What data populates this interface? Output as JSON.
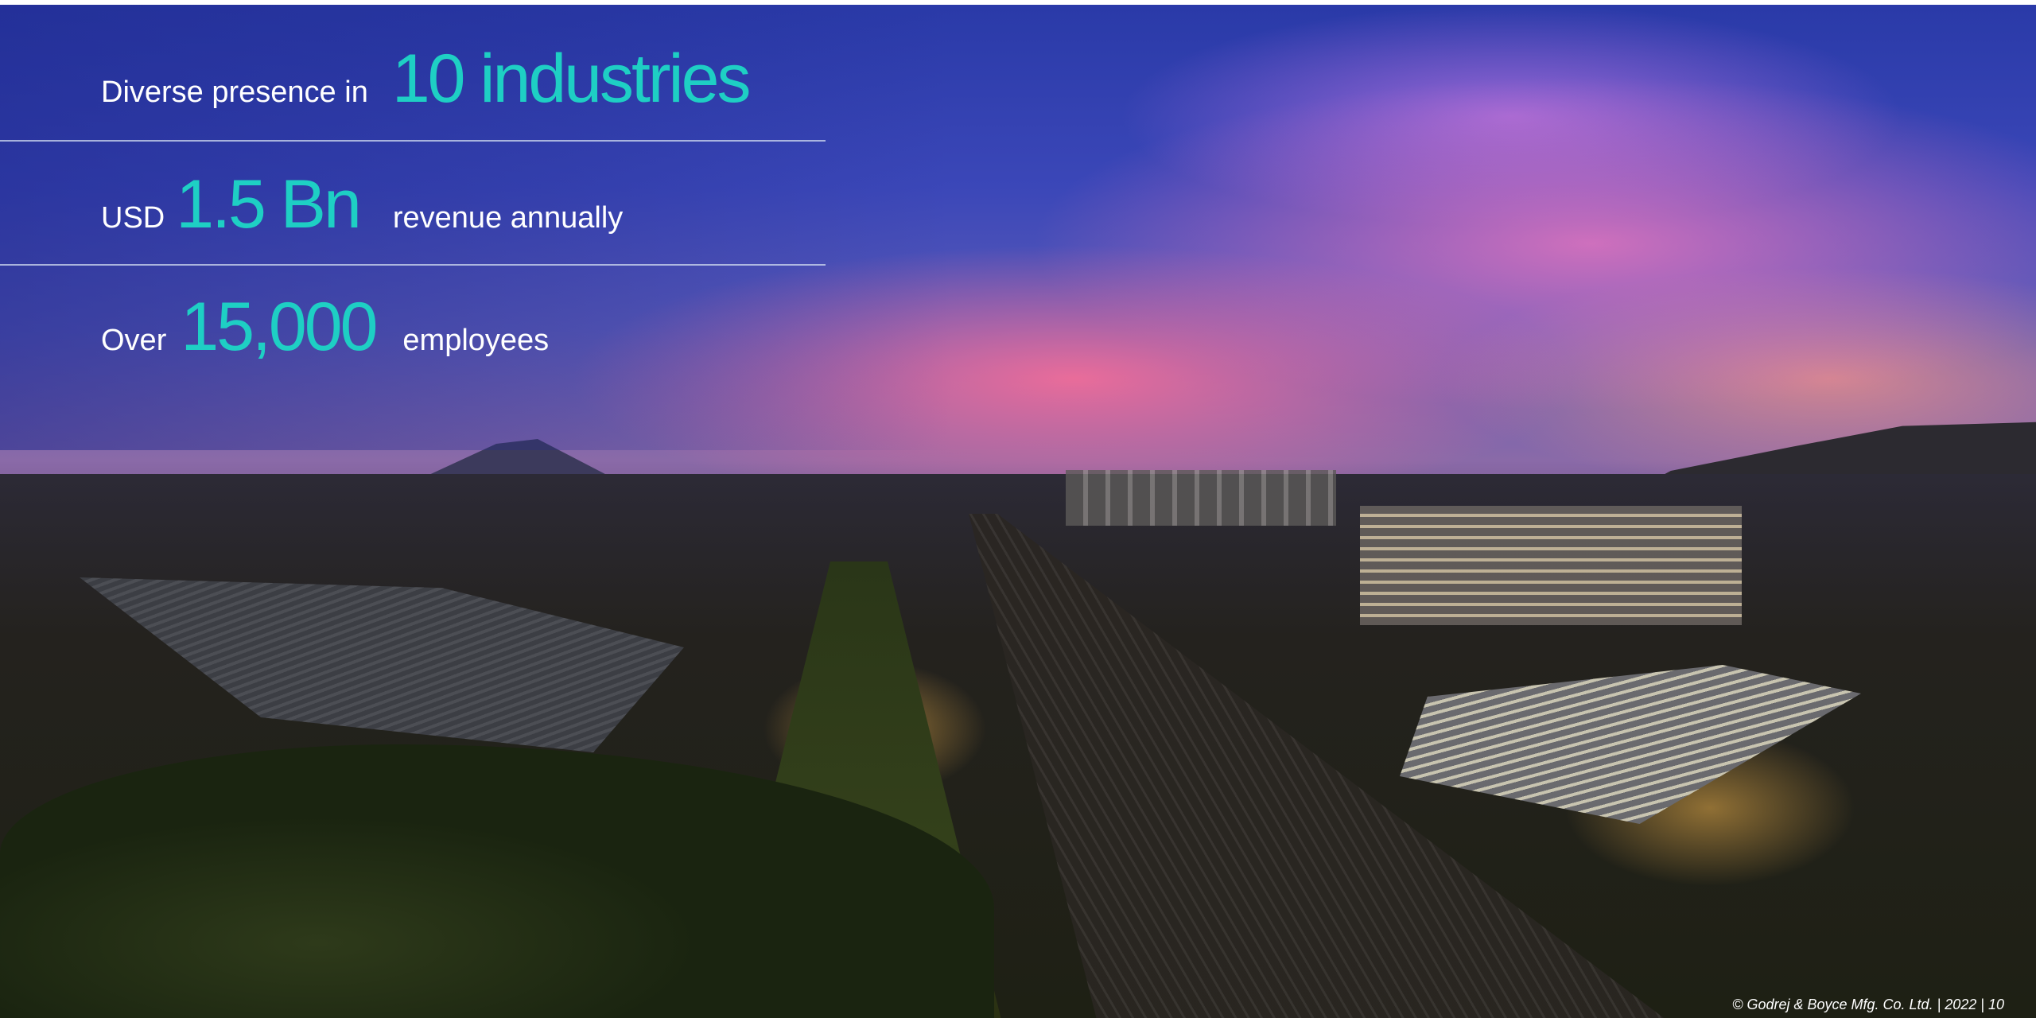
{
  "stats": {
    "industries": {
      "prefix": "Diverse presence in",
      "value": "10 industries"
    },
    "revenue": {
      "prefix": "USD",
      "value": "1.5 Bn",
      "suffix": "revenue annually"
    },
    "employees": {
      "prefix": "Over",
      "value": "15,000",
      "suffix": "employees"
    }
  },
  "footer": {
    "text": "© Godrej & Boyce Mfg. Co. Ltd. | 2022 | 10"
  },
  "colors": {
    "accent": "#1ecfc4",
    "text": "#ffffff"
  }
}
